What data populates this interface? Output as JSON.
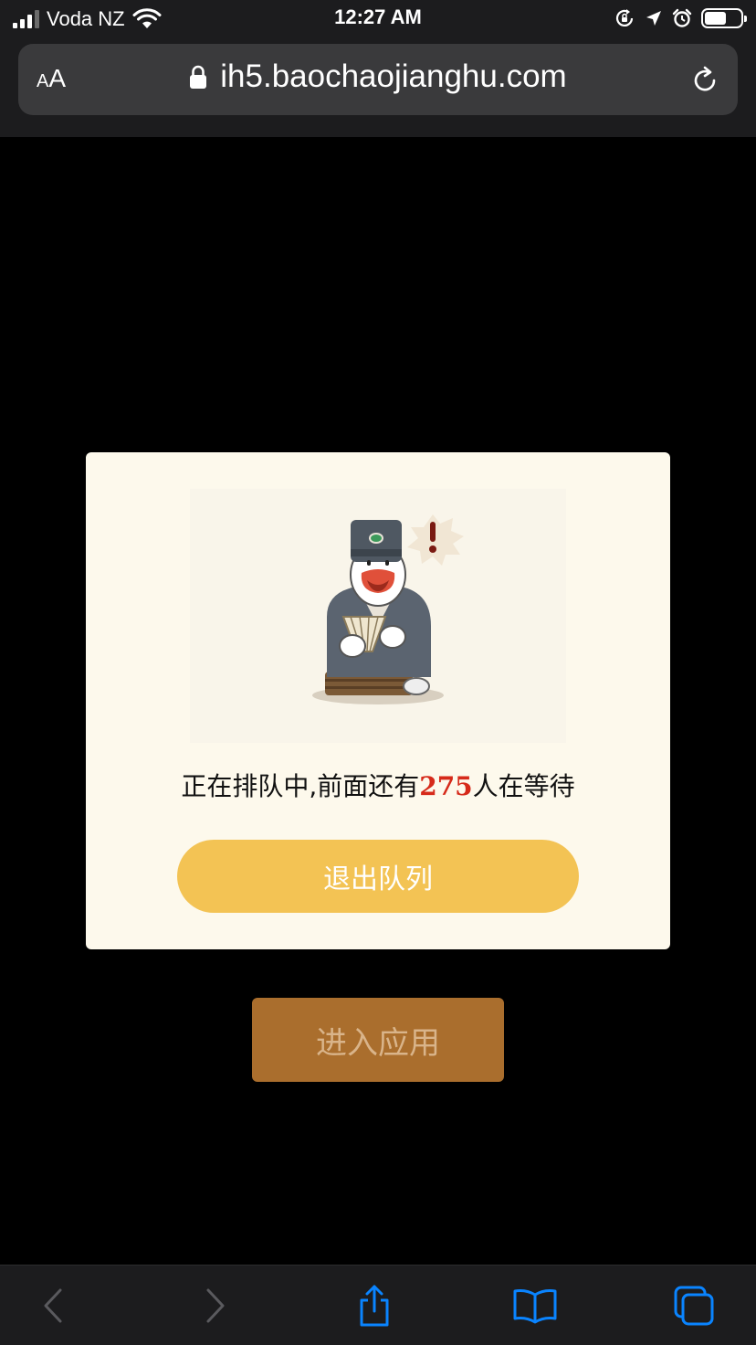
{
  "status_bar": {
    "carrier": "Voda NZ",
    "time": "12:27 AM",
    "battery_level": 0.6
  },
  "browser": {
    "text_size_label_small": "A",
    "text_size_label_large": "A",
    "url": "ih5.baochaojianghu.com"
  },
  "dialog": {
    "illustration": "queue-mascot-duck-illustration",
    "queue_prefix": "正在排队中,前面还有",
    "queue_count": "275",
    "queue_suffix": "人在等待",
    "exit_button_label": "退出队列"
  },
  "enter_button_label": "进入应用",
  "colors": {
    "exit_button": "#f3c354",
    "enter_button": "#aa6e2d",
    "queue_count": "#d62a1a",
    "dialog_bg": "#fdf9ec",
    "safari_link_blue": "#0a84ff"
  },
  "toolbar": {
    "back_icon": "chevron-left-icon",
    "forward_icon": "chevron-right-icon",
    "share_icon": "share-icon",
    "bookmarks_icon": "book-icon",
    "tabs_icon": "tabs-icon"
  }
}
